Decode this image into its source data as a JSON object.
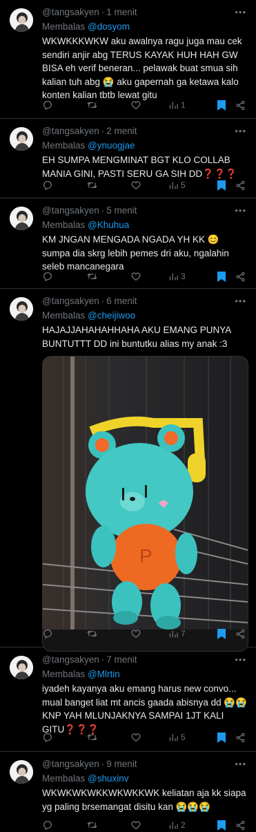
{
  "reply_prefix": "Membalas",
  "tweets": [
    {
      "name": "",
      "handle": "@tangsakyen",
      "time": "1 menit",
      "reply_to": "@dosyom",
      "text": "WKWKKKWKW aku awalnya ragu juga mau cek sendiri anjir abg TERUS KAYAK HUH HAH GW BISA eh verif beneran... pelawak buat smua sih kalian tuh abg 😭 aku gapernah ga ketawa kalo konten kalian tbtb lewat gitu",
      "views": "1"
    },
    {
      "name": "",
      "handle": "@tangsakyen",
      "time": "2 menit",
      "reply_to": "@ynuogjae",
      "text": "EH SUMPA MENGMINAT BGT KLO COLLAB MANIA GINI, PASTI SERU GA SIH DD❓❓❓",
      "views": "5"
    },
    {
      "name": "",
      "handle": "@tangsakyen",
      "time": "5 menit",
      "reply_to": "@Khuhua",
      "text": "KM JNGAN MENGADA NGADA YH KK 😊 sumpa dia skrg lebih pemes dri aku, ngalahin seleb mancanegara",
      "views": "3"
    },
    {
      "name": "",
      "handle": "@tangsakyen",
      "time": "6 menit",
      "reply_to": "@cheijiwoo",
      "text": "HAJAJJAHAHAHHAHA AKU EMANG PUNYA BUNTUTTT DD ini buntutku alias my anak :3",
      "views": "7"
    },
    {
      "name": "",
      "handle": "@tangsakyen",
      "time": "7 menit",
      "reply_to": "@Mlrtin",
      "text": "iyadeh kayanya aku emang harus new convo... mual banget liat mt ancis gaada abisnya dd 😭😭 KNP YAH MLUNJAKNYA SAMPAI 1JT KALI GITU❓❓❓",
      "views": "5"
    },
    {
      "name": "",
      "handle": "@tangsakyen",
      "time": "9 menit",
      "reply_to": "@shuxinv",
      "text": "WKWKWKWKKWKWKKWK keliatan aja kk siapa yg paling brsemangat disitu kan 😭😭😭",
      "views": "2"
    }
  ],
  "icons": {
    "reply": "reply-icon",
    "retweet": "retweet-icon",
    "like": "heart-icon",
    "views": "views-chart-icon",
    "bookmark": "bookmark-icon",
    "share": "share-icon",
    "more": "more-icon"
  },
  "colors": {
    "background": "#000000",
    "text": "#e7e9ea",
    "muted": "#71767b",
    "link": "#1d9bf0",
    "bookmark": "#1d9bf0",
    "divider": "#2f3336"
  }
}
